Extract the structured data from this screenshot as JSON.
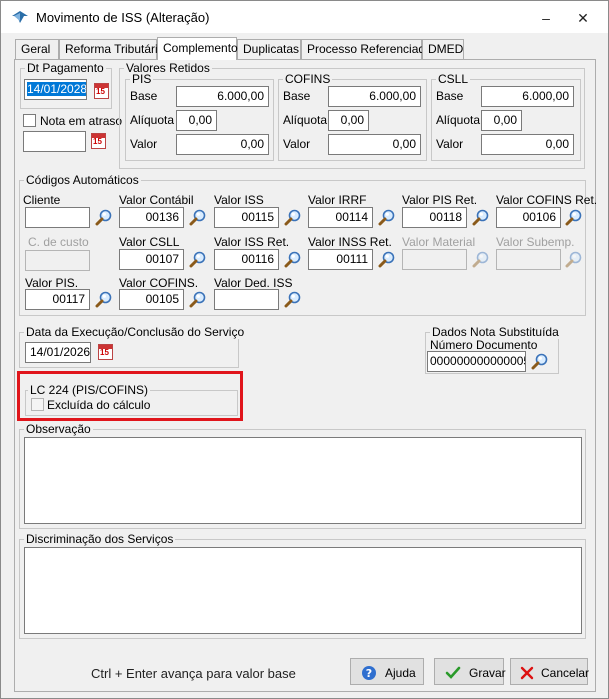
{
  "window": {
    "title": "Movimento de ISS (Alteração)",
    "minimize_glyph": "–",
    "maximize_glyph": "□",
    "close_glyph": "✕"
  },
  "tabs": [
    "Geral",
    "Reforma Tributária",
    "Complemento",
    "Duplicatas",
    "Processo Referenciado",
    "DMED"
  ],
  "active_tab": "Complemento",
  "dt_pagamento": {
    "label": "Dt Pagamento",
    "value": "14/01/2028"
  },
  "nota_em_atraso": {
    "label": "Nota em atraso",
    "checked": false,
    "value": ""
  },
  "valores_retidos": {
    "label": "Valores Retidos",
    "pis": {
      "label": "PIS",
      "base_label": "Base",
      "base": "6.000,00",
      "aliquota_label": "Alíquota",
      "aliquota": "0,00",
      "valor_label": "Valor",
      "valor": "0,00"
    },
    "cofins": {
      "label": "COFINS",
      "base_label": "Base",
      "base": "6.000,00",
      "aliquota_label": "Alíquota",
      "aliquota": "0,00",
      "valor_label": "Valor",
      "valor": "0,00"
    },
    "csll": {
      "label": "CSLL",
      "base_label": "Base",
      "base": "6.000,00",
      "aliquota_label": "Alíquota",
      "aliquota": "0,00",
      "valor_label": "Valor",
      "valor": "0,00"
    }
  },
  "codigos": {
    "label": "Códigos Automáticos",
    "cliente": {
      "label": "Cliente",
      "value": ""
    },
    "valor_contabil": {
      "label": "Valor Contábil",
      "value": "00136"
    },
    "valor_iss": {
      "label": "Valor ISS",
      "value": "00115"
    },
    "valor_irrf": {
      "label": "Valor IRRF",
      "value": "00114"
    },
    "valor_pis_ret": {
      "label": "Valor PIS Ret.",
      "value": "00118"
    },
    "valor_cofins_ret": {
      "label": "Valor COFINS Ret.",
      "value": "00106"
    },
    "c_de_custo": {
      "label": "C. de custo",
      "value": ""
    },
    "valor_csll": {
      "label": "Valor CSLL",
      "value": "00107"
    },
    "valor_iss_ret": {
      "label": "Valor ISS Ret.",
      "value": "00116"
    },
    "valor_inss_ret": {
      "label": "Valor INSS Ret.",
      "value": "00111"
    },
    "valor_material": {
      "label": "Valor Material",
      "value": ""
    },
    "valor_subemp": {
      "label": "Valor Subemp.",
      "value": ""
    },
    "valor_pis": {
      "label": "Valor PIS.",
      "value": "00117"
    },
    "valor_cofins": {
      "label": "Valor COFINS.",
      "value": "00105"
    },
    "valor_ded_iss": {
      "label": "Valor Ded. ISS",
      "value": ""
    }
  },
  "data_execucao": {
    "label": "Data da Execução/Conclusão do Serviço",
    "value": "14/01/2026"
  },
  "nota_substituida": {
    "label": "Dados Nota Substituída",
    "numero_label": "Número Documento",
    "numero": "000000000000005"
  },
  "lc224": {
    "label": "LC 224 (PIS/COFINS)",
    "excluida_label": "Excluída do cálculo",
    "checked": false
  },
  "observacao": {
    "label": "Observação",
    "value": ""
  },
  "discriminacao": {
    "label": "Discriminação dos Serviços",
    "value": ""
  },
  "footer": {
    "hint": "Ctrl + Enter avança para valor base",
    "ajuda": "Ajuda",
    "gravar": "Gravar",
    "cancelar": "Cancelar"
  },
  "colors": {
    "highlight_border": "#e0151b",
    "selection": "#0078d7"
  },
  "calendar_icon_text": "15"
}
